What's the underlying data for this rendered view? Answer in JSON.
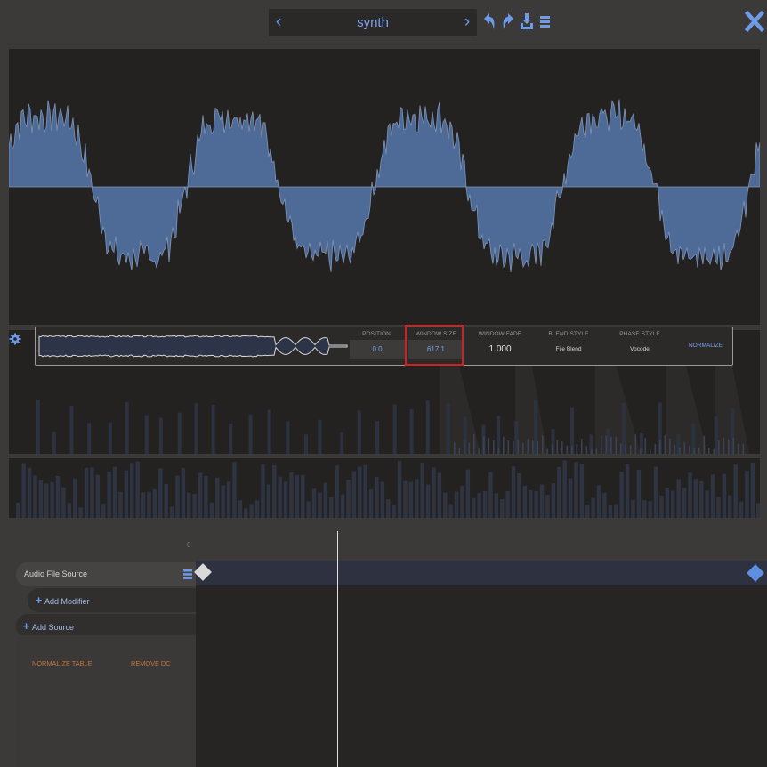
{
  "topbar": {
    "preset_name": "synth",
    "prev_glyph": "‹",
    "next_glyph": "›",
    "icons": [
      "undo-icon",
      "redo-icon",
      "save-icon",
      "menu-icon",
      "close-icon"
    ]
  },
  "colors": {
    "accent": "#6f9ae8",
    "waveform_fill": "#4e6a96",
    "panel_bg": "#232221",
    "app_bg": "#3b3a39",
    "highlight": "#d42020",
    "orange_button": "#c2743a"
  },
  "spectrum_strip": {
    "params": [
      {
        "label": "POSITION",
        "value": "0.0"
      },
      {
        "label": "WINDOW SIZE",
        "value": "617.1"
      },
      {
        "label": "WINDOW FADE",
        "value": "1.000"
      },
      {
        "label": "BLEND STYLE",
        "value": "File Blend"
      },
      {
        "label": "PHASE STYLE",
        "value": "Vocode"
      }
    ],
    "normalize_label": "NORMALIZE"
  },
  "timeline": {
    "ruler_start": "0"
  },
  "sources": {
    "audio_file_source": "Audio File Source",
    "add_modifier": "Add Modifier",
    "add_source": "Add Source"
  },
  "modifier_buttons": {
    "normalize_table": "NORMALIZE TABLE",
    "remove_dc": "REMOVE DC"
  }
}
